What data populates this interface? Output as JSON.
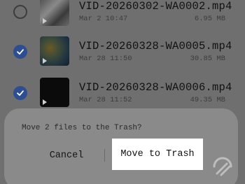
{
  "files": [
    {
      "name": "VID-20260302-WA0002.mp4",
      "date": "Mar 2 10:47",
      "size": "6.95 MB",
      "selected": false
    },
    {
      "name": "VID-20260328-WA0005.mp4",
      "date": "Mar 28 11:50",
      "size": "30.85 MB",
      "selected": true
    },
    {
      "name": "VID-20260328-WA0006.mp4",
      "date": "Mar 28 11:52",
      "size": "49.35 MB",
      "selected": true
    }
  ],
  "dialog": {
    "message": "Move 2 files to the Trash?",
    "cancel_label": "Cancel",
    "confirm_label": "Move to Trash"
  },
  "colors": {
    "scrim": "#6f6f6f",
    "checkbox_selected": "#2d4f92",
    "dialog_bg": "#8a8a8a",
    "confirm_button_bg": "#ffffff"
  },
  "icons": {
    "checked": "check-circle-icon",
    "unchecked": "empty-circle-icon",
    "video_play": "play-icon",
    "watermark": "gadgets-logo-icon"
  }
}
